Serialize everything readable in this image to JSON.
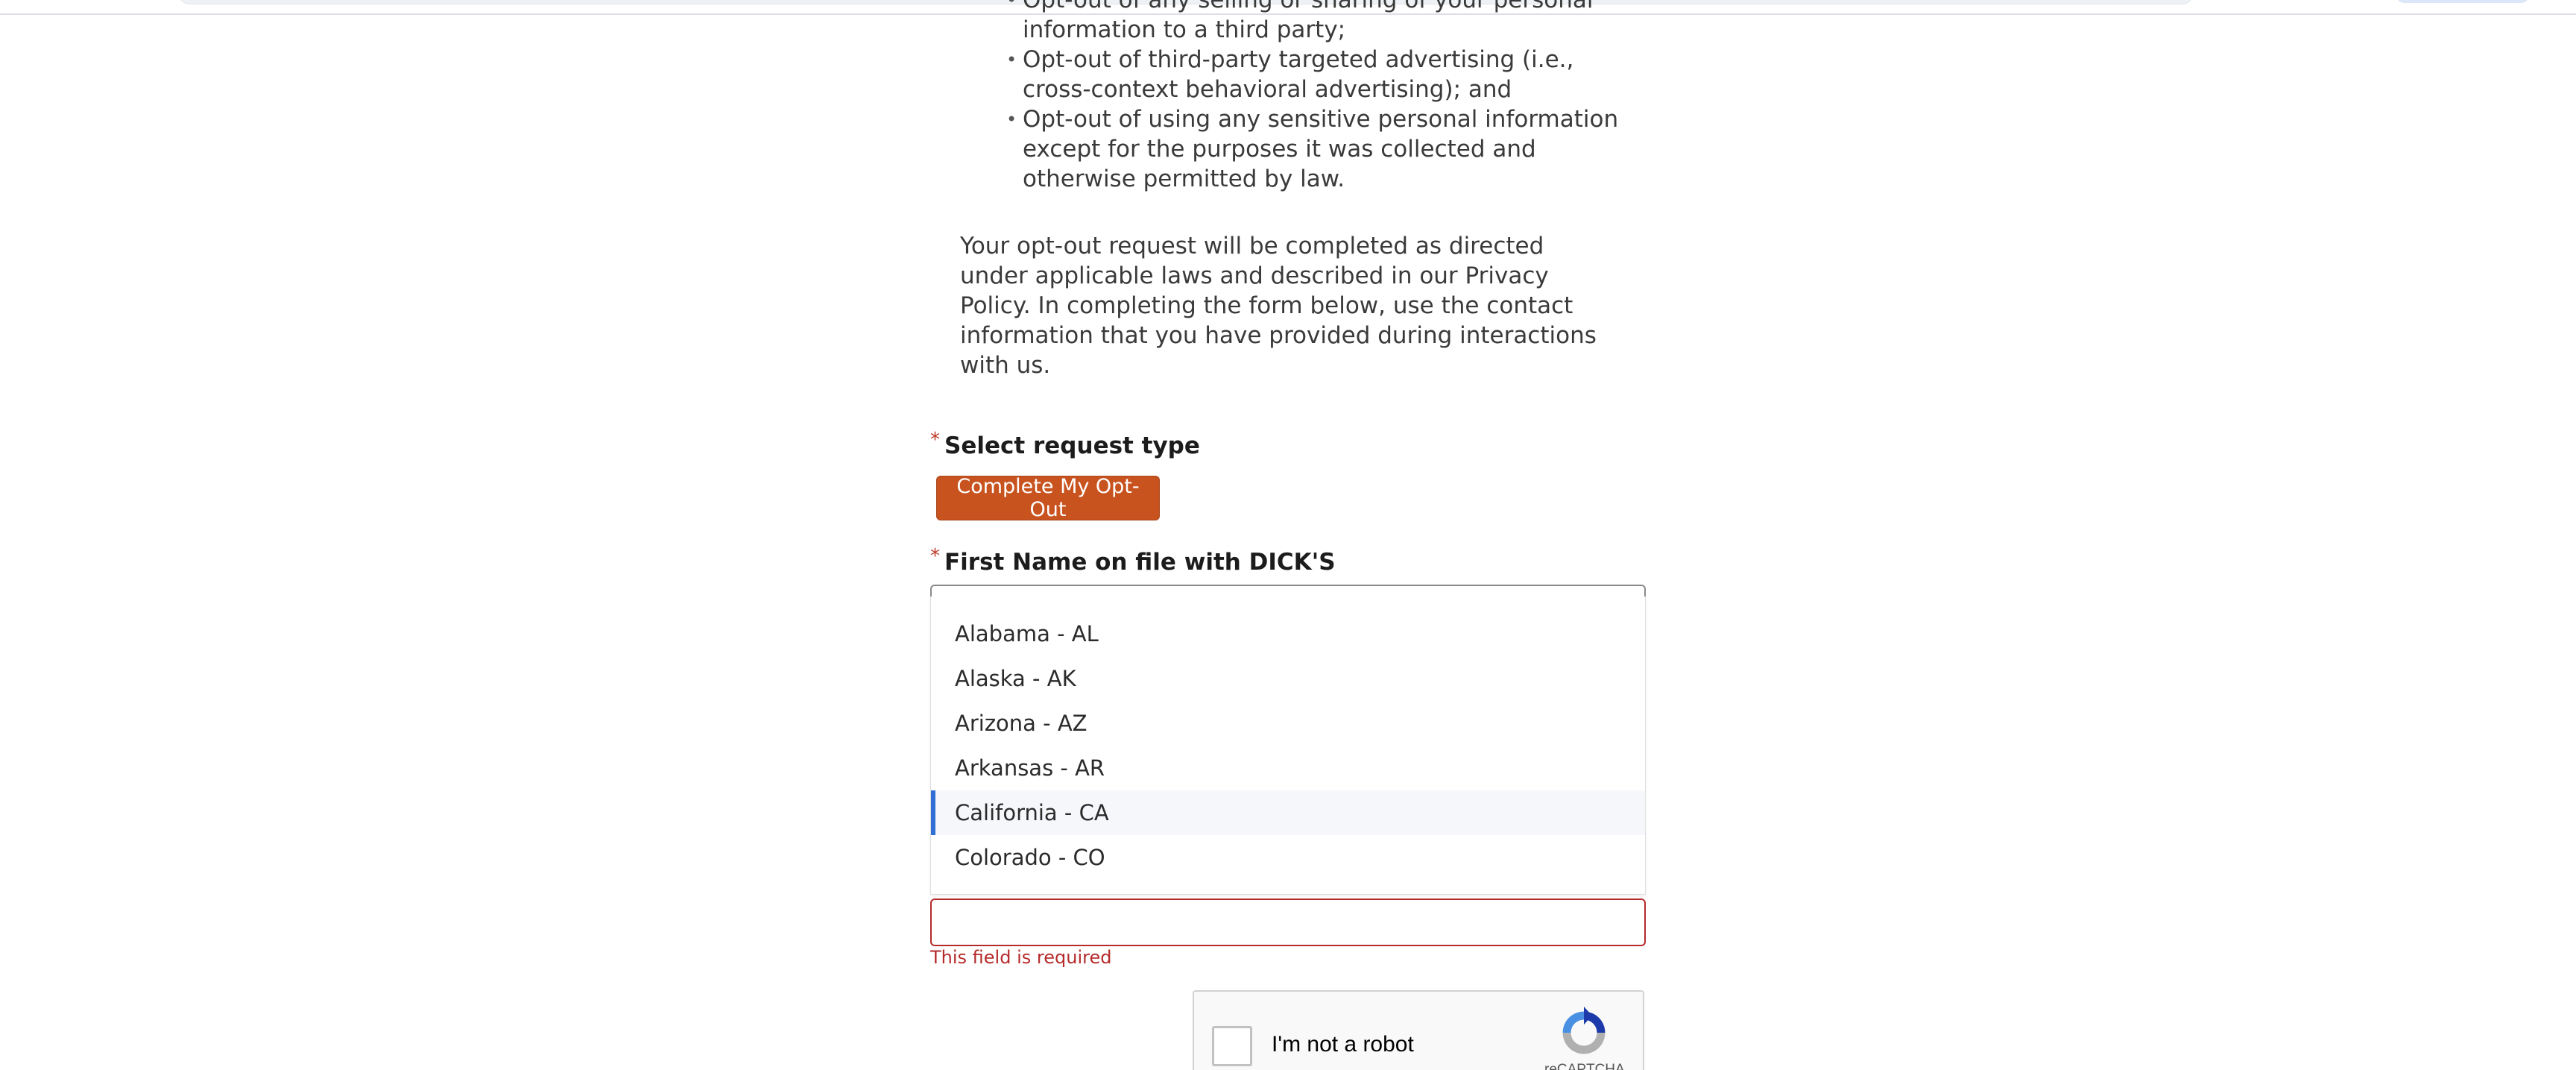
{
  "bullets": [
    "Opt-out of any selling or sharing of your personal information to a third party;",
    "Opt-out of third-party targeted advertising (i.e., cross-context behavioral advertising); and",
    "Opt-out of using any sensitive personal information except for the purposes it was collected and otherwise permitted by law."
  ],
  "paragraph": "Your opt-out request will be completed as directed under applicable laws and described in our Privacy Policy. In completing the form below, use the contact information that you have provided during interactions with us.",
  "request_type": {
    "required_marker": "*",
    "label": "Select request type",
    "button_label": "Complete My Opt-Out"
  },
  "first_name": {
    "required_marker": "*",
    "label": "First Name on file with DICK'S"
  },
  "state_dropdown": {
    "options": [
      "Alabama - AL",
      "Alaska - AK",
      "Arizona - AZ",
      "Arkansas - AR",
      "California - CA",
      "Colorado - CO"
    ],
    "highlighted": "California - CA"
  },
  "validation": {
    "error_text": "This field is required"
  },
  "captcha": {
    "label": "I'm not a robot",
    "brand": "reCAPTCHA"
  },
  "colors": {
    "accent": "#c8531f",
    "error": "#b52b2b",
    "highlight_bar": "#2f6fd6"
  }
}
